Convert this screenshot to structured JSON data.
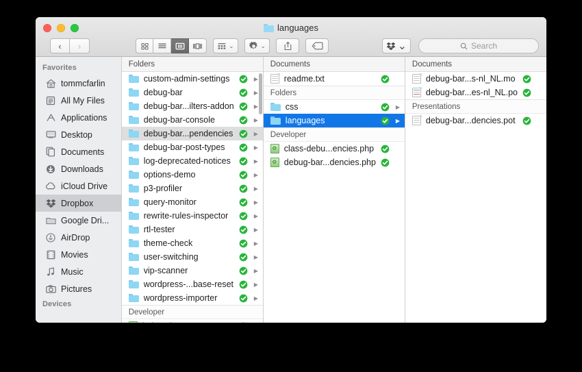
{
  "window": {
    "title": "languages",
    "title_icon": "folder-icon",
    "traffic_lights": [
      "close",
      "minimize",
      "maximize"
    ]
  },
  "toolbar": {
    "back_label": "‹",
    "forward_label": "›",
    "view_icon_label": "icon-view-icon",
    "view_list_label": "list-view-icon",
    "view_column_label": "column-view-icon",
    "view_coverflow_label": "coverflow-view-icon",
    "arrange_label": "arrange-icon",
    "action_label": "gear-icon",
    "share_label": "share-icon",
    "tag_label": "tag-icon",
    "dropbox_label": "dropbox-icon",
    "caret": "⌄",
    "search_placeholder": "Search"
  },
  "sidebar": {
    "sections": [
      {
        "header": "Favorites",
        "items": [
          {
            "label": "tommcfarlin",
            "icon": "home-icon",
            "selected": false
          },
          {
            "label": "All My Files",
            "icon": "all-my-files-icon",
            "selected": false
          },
          {
            "label": "Applications",
            "icon": "applications-icon",
            "selected": false
          },
          {
            "label": "Desktop",
            "icon": "desktop-icon",
            "selected": false
          },
          {
            "label": "Documents",
            "icon": "documents-icon",
            "selected": false
          },
          {
            "label": "Downloads",
            "icon": "downloads-icon",
            "selected": false
          },
          {
            "label": "iCloud Drive",
            "icon": "icloud-icon",
            "selected": false
          },
          {
            "label": "Dropbox",
            "icon": "dropbox-icon",
            "selected": true
          },
          {
            "label": "Google Dri...",
            "icon": "folder-icon",
            "selected": false
          },
          {
            "label": "AirDrop",
            "icon": "airdrop-icon",
            "selected": false
          },
          {
            "label": "Movies",
            "icon": "movies-icon",
            "selected": false
          },
          {
            "label": "Music",
            "icon": "music-icon",
            "selected": false
          },
          {
            "label": "Pictures",
            "icon": "pictures-icon",
            "selected": false
          }
        ]
      },
      {
        "header": "Devices",
        "items": []
      }
    ]
  },
  "columns": [
    {
      "header": "Folders",
      "groups": [
        {
          "label": null,
          "rows": [
            {
              "name": "custom-admin-settings",
              "icon": "folder-icon",
              "badge": "sync-check-icon",
              "arrow": true,
              "selected": null
            },
            {
              "name": "debug-bar",
              "icon": "folder-icon",
              "badge": "sync-check-icon",
              "arrow": true,
              "selected": null
            },
            {
              "name": "debug-bar...ilters-addon",
              "icon": "folder-icon",
              "badge": "sync-check-icon",
              "arrow": true,
              "selected": null
            },
            {
              "name": "debug-bar-console",
              "icon": "folder-icon",
              "badge": "sync-check-icon",
              "arrow": true,
              "selected": null
            },
            {
              "name": "debug-bar...pendencies",
              "icon": "folder-icon",
              "badge": "sync-check-icon",
              "arrow": true,
              "selected": "gray"
            },
            {
              "name": "debug-bar-post-types",
              "icon": "folder-icon",
              "badge": "sync-check-icon",
              "arrow": true,
              "selected": null
            },
            {
              "name": "log-deprecated-notices",
              "icon": "folder-icon",
              "badge": "sync-check-icon",
              "arrow": true,
              "selected": null
            },
            {
              "name": "options-demo",
              "icon": "folder-icon",
              "badge": "sync-check-icon",
              "arrow": true,
              "selected": null
            },
            {
              "name": "p3-profiler",
              "icon": "folder-icon",
              "badge": "sync-check-icon",
              "arrow": true,
              "selected": null
            },
            {
              "name": "query-monitor",
              "icon": "folder-icon",
              "badge": "sync-check-icon",
              "arrow": true,
              "selected": null
            },
            {
              "name": "rewrite-rules-inspector",
              "icon": "folder-icon",
              "badge": "sync-check-icon",
              "arrow": true,
              "selected": null
            },
            {
              "name": "rtl-tester",
              "icon": "folder-icon",
              "badge": "sync-check-icon",
              "arrow": true,
              "selected": null
            },
            {
              "name": "theme-check",
              "icon": "folder-icon",
              "badge": "sync-check-icon",
              "arrow": true,
              "selected": null
            },
            {
              "name": "user-switching",
              "icon": "folder-icon",
              "badge": "sync-check-icon",
              "arrow": true,
              "selected": null
            },
            {
              "name": "vip-scanner",
              "icon": "folder-icon",
              "badge": "sync-check-icon",
              "arrow": true,
              "selected": null
            },
            {
              "name": "wordpress-...base-reset",
              "icon": "folder-icon",
              "badge": "sync-check-icon",
              "arrow": true,
              "selected": null
            },
            {
              "name": "wordpress-importer",
              "icon": "folder-icon",
              "badge": "sync-check-icon",
              "arrow": true,
              "selected": null
            }
          ]
        },
        {
          "label": "Developer",
          "rows": [
            {
              "name": "index.php",
              "icon": "php-file-icon",
              "badge": "sync-check-icon",
              "arrow": false,
              "selected": null
            }
          ]
        }
      ]
    },
    {
      "header": "Documents",
      "groups": [
        {
          "label": null,
          "rows": [
            {
              "name": "readme.txt",
              "icon": "document-icon",
              "badge": "sync-check-icon",
              "arrow": false,
              "selected": null
            }
          ]
        },
        {
          "label": "Folders",
          "rows": [
            {
              "name": "css",
              "icon": "folder-icon",
              "badge": "sync-check-icon",
              "arrow": true,
              "selected": null
            },
            {
              "name": "languages",
              "icon": "folder-icon",
              "badge": "sync-check-icon",
              "arrow": true,
              "selected": "blue"
            }
          ]
        },
        {
          "label": "Developer",
          "rows": [
            {
              "name": "class-debu...encies.php",
              "icon": "php-file-icon",
              "badge": "sync-check-icon",
              "arrow": false,
              "selected": null
            },
            {
              "name": "debug-bar...dencies.php",
              "icon": "php-file-icon",
              "badge": "sync-check-icon",
              "arrow": false,
              "selected": null
            }
          ]
        }
      ]
    },
    {
      "header": "Documents",
      "groups": [
        {
          "label": null,
          "rows": [
            {
              "name": "debug-bar...s-nl_NL.mo",
              "icon": "document-icon",
              "badge": "sync-check-icon",
              "arrow": false,
              "selected": null
            },
            {
              "name": "debug-bar...es-nl_NL.po",
              "icon": "po-file-icon",
              "badge": "sync-check-icon",
              "arrow": false,
              "selected": null
            }
          ]
        },
        {
          "label": "Presentations",
          "rows": [
            {
              "name": "debug-bar...dencies.pot",
              "icon": "document-icon",
              "badge": "sync-check-icon",
              "arrow": false,
              "selected": null
            }
          ]
        }
      ]
    }
  ],
  "colors": {
    "selection_blue": "#1277e6",
    "selection_gray": "#dedede",
    "sync_green": "#27b53a",
    "folder_blue": "#8ed6f4",
    "sidebar_bg": "#ecedef",
    "titlebar_top": "#e9e9e9",
    "desktop_bg": "#000000"
  }
}
